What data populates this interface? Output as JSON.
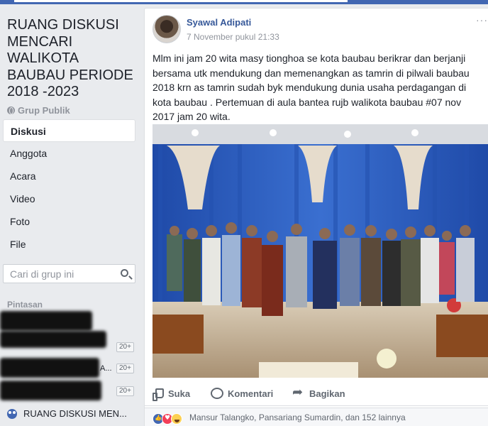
{
  "sidebar": {
    "group_name": "RUANG DISKUSI MENCARI WALIKOTA BAUBAU PERIODE 2018 -2023",
    "group_type": "Grup Publik",
    "nav": [
      {
        "label": "Diskusi",
        "active": true
      },
      {
        "label": "Anggota",
        "active": false
      },
      {
        "label": "Acara",
        "active": false
      },
      {
        "label": "Video",
        "active": false
      },
      {
        "label": "Foto",
        "active": false
      },
      {
        "label": "File",
        "active": false
      }
    ],
    "search_placeholder": "Cari di grup ini",
    "shortcuts_label": "Pintasan",
    "shortcuts": [
      {
        "count": "20+",
        "peek": ""
      },
      {
        "count": "20+",
        "peek": "A..."
      },
      {
        "count": "20+",
        "peek": ""
      }
    ],
    "current_group_label": "RUANG DISKUSI MEN..."
  },
  "post": {
    "author": "Syawal Adipati",
    "timestamp": "7 November pukul 21:33",
    "more": "···",
    "text": "Mlm ini jam 20 wita masy tionghoa se kota baubau berikrar dan berjanji bersama utk mendukung dan memenangkan as tamrin di pilwali baubau 2018 krn as tamrin sudah byk mendukung dunia usaha perdagangan di kota baubau . Pertemuan di aula bantea rujb walikota baubau #07 nov 2017 jam 20 wita.",
    "actions": {
      "like": "Suka",
      "comment": "Komentari",
      "share": "Bagikan"
    },
    "reactions_text": "Mansur Talangko, Pansariang Sumardin, dan 152 lainnya"
  },
  "colors": {
    "fb_blue": "#4267b2",
    "link": "#365899",
    "curtain_blue": "#2c5bb5"
  },
  "icons": [
    "globe-icon",
    "search-icon",
    "group-icon",
    "like-icon",
    "comment-icon",
    "share-icon",
    "reaction-like-icon",
    "reaction-love-icon",
    "reaction-haha-icon",
    "more-options-icon"
  ]
}
